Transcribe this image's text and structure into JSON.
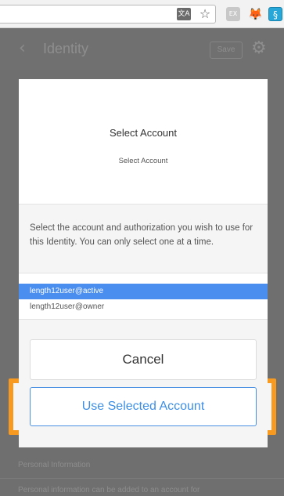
{
  "browser": {
    "icons": [
      "translate-icon",
      "star-icon",
      "extension-icon",
      "metamask-icon",
      "scatter-icon"
    ],
    "ext_gray_label": "EX"
  },
  "app": {
    "title": "Identity",
    "save_label": "Save",
    "section_label": "Personal Information",
    "section_text": "Personal information can be added to an account for"
  },
  "modal": {
    "title": "Select Account",
    "subtitle": "Select Account",
    "description": "Select the account and authorization you wish to use for this Identity. You can only select one at a time.",
    "accounts": [
      {
        "label": "length12user@active",
        "selected": true
      },
      {
        "label": "length12user@owner",
        "selected": false
      }
    ],
    "cancel_label": "Cancel",
    "use_label": "Use Selected Account"
  },
  "colors": {
    "highlight": "#f79a1f",
    "selected_row": "#4a8ef0",
    "primary_text": "#3d8fe6"
  }
}
